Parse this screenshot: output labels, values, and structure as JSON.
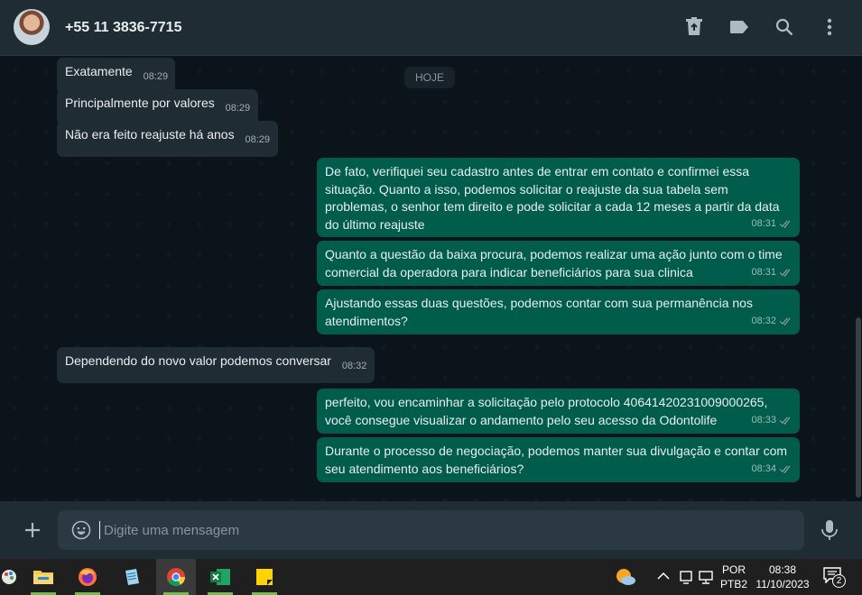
{
  "header": {
    "contact_name": "+55 11 3836-7715",
    "icons": [
      "archive-icon",
      "label-icon",
      "search-icon",
      "menu-icon"
    ]
  },
  "chat": {
    "day_chip": "HOJE",
    "messages": [
      {
        "direction": "in",
        "text": "Exatamente",
        "time": "08:29"
      },
      {
        "direction": "in",
        "text": "Principalmente por valores",
        "time": "08:29"
      },
      {
        "direction": "in",
        "text": "Não era feito reajuste há anos",
        "time": "08:29"
      },
      {
        "direction": "out",
        "text": "De fato, verifiquei seu cadastro antes de entrar em contato e confirmei essa situação. Quanto a isso, podemos solicitar o reajuste da sua tabela sem problemas, o senhor tem direito e pode solicitar a cada 12 meses a partir da data do último reajuste",
        "time": "08:31"
      },
      {
        "direction": "out",
        "text": "Quanto a questão da baixa procura, podemos realizar uma ação junto com o time comercial da operadora para indicar beneficiários para sua clinica",
        "time": "08:31"
      },
      {
        "direction": "out",
        "text": "Ajustando essas duas questões, podemos contar com sua permanência nos atendimentos?",
        "time": "08:32"
      },
      {
        "direction": "in",
        "text": "Dependendo do novo valor podemos conversar",
        "time": "08:32"
      },
      {
        "direction": "out",
        "text": "perfeito, vou encaminhar a solicitação pelo protocolo 40641420231009000265, você consegue visualizar o andamento pelo seu acesso da Odontolife",
        "time": "08:33"
      },
      {
        "direction": "out",
        "text": "Durante o processo de negociação, podemos manter sua divulgação e contar com seu atendimento aos beneficiários?",
        "time": "08:34"
      }
    ]
  },
  "composer": {
    "placeholder": "Digite uma mensagem"
  },
  "taskbar": {
    "apps": [
      "paint-app-icon",
      "file-explorer-icon",
      "firefox-icon",
      "notepad-icon",
      "chrome-icon",
      "excel-icon",
      "sticky-notes-icon"
    ],
    "language_line1": "POR",
    "language_line2": "PTB2",
    "time": "08:38",
    "date": "11/10/2023",
    "notification_count": "2"
  },
  "colors": {
    "incoming_bubble": "#202c33",
    "outgoing_bubble": "#005c4b",
    "chat_background": "#0b141a",
    "header_background": "#202c33"
  }
}
